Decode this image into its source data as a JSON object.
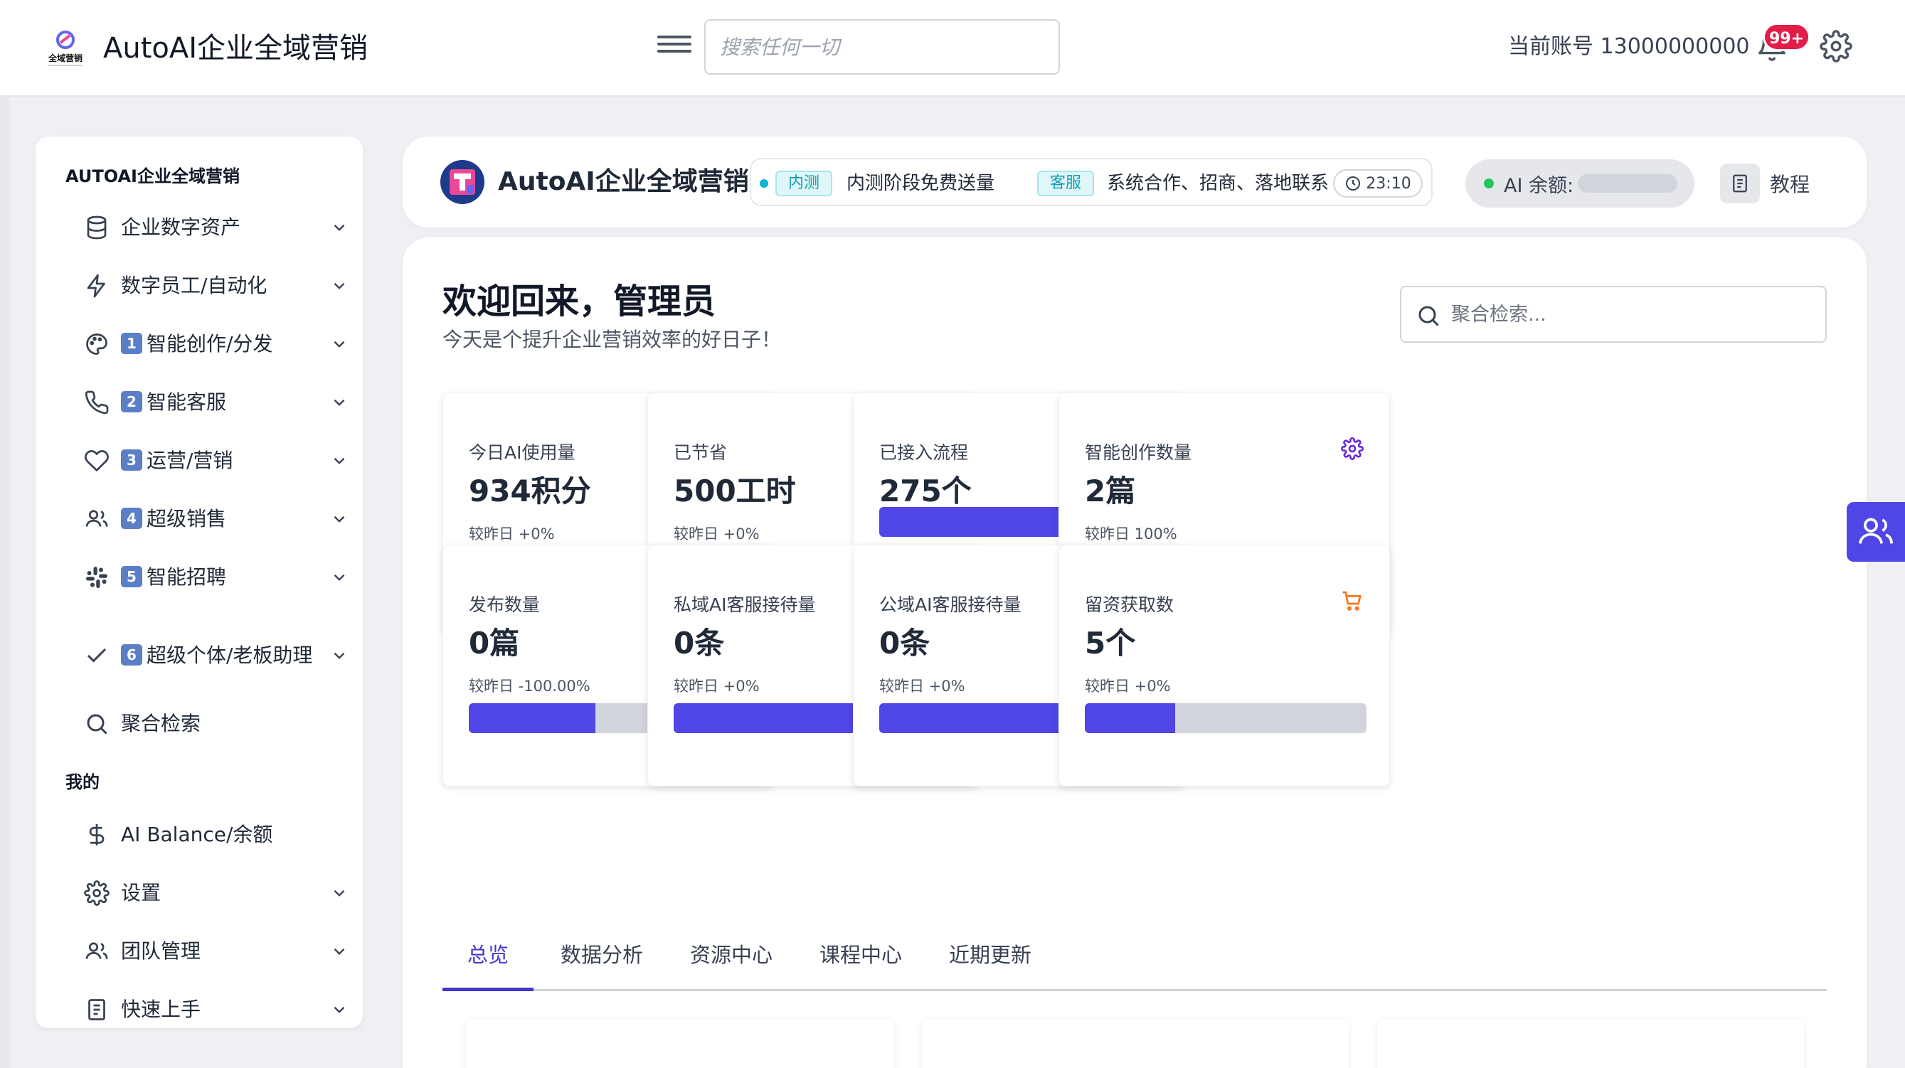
{
  "topbar": {
    "logo_text": "全域营销",
    "app_title": "AutoAI企业全域营销",
    "search_placeholder": "搜索任何一切",
    "account_label": "当前账号 13000000000",
    "notification_badge": "99+"
  },
  "sidebar": {
    "section_main": "AUTOAI企业全域营销",
    "items": [
      {
        "label": "企业数字资产",
        "icon": "database-icon",
        "expandable": true
      },
      {
        "label": "数字员工/自动化",
        "icon": "lightning-icon",
        "expandable": true
      },
      {
        "num": "1",
        "label": "智能创作/分发",
        "icon": "palette-icon",
        "expandable": true
      },
      {
        "num": "2",
        "label": "智能客服",
        "icon": "phone-icon",
        "expandable": true
      },
      {
        "num": "3",
        "label": "运营/营销",
        "icon": "heart-icon",
        "expandable": true
      },
      {
        "num": "4",
        "label": "超级销售",
        "icon": "users-icon",
        "expandable": true
      },
      {
        "num": "5",
        "label": "智能招聘",
        "icon": "slack-icon",
        "expandable": true
      },
      {
        "num": "6",
        "label": "超级个体/老板助理",
        "icon": "check-icon",
        "expandable": true
      },
      {
        "label": "聚合检索",
        "icon": "search-icon",
        "expandable": false
      }
    ],
    "section_mine": "我的",
    "mine_items": [
      {
        "label": "AI Balance/余额",
        "icon": "dollar-icon",
        "expandable": false
      },
      {
        "label": "设置",
        "icon": "gear-icon",
        "expandable": true
      },
      {
        "label": "团队管理",
        "icon": "users-icon",
        "expandable": true
      },
      {
        "label": "快速上手",
        "icon": "book-icon",
        "expandable": true
      }
    ]
  },
  "header": {
    "brand_name": "AutoAI企业全域营销",
    "ticker": {
      "tag1": "内测",
      "text1": "内测阶段免费送量",
      "tag2": "客服",
      "text2": "系统合作、招商、落地联系",
      "time": "23:10"
    },
    "balance_label": "AI 余额:",
    "tutorial_label": "教程"
  },
  "main": {
    "welcome_title": "欢迎回来，管理员",
    "welcome_subtitle": "今天是个提升企业营销效率的好日子！",
    "search_placeholder": "聚合检索...",
    "stats": [
      {
        "label": "今日AI使用量",
        "value": "934积分",
        "compare": "较昨日 +0%",
        "progress": 0.65,
        "icon": "lightning-icon",
        "icon_color": "#2563eb"
      },
      {
        "label": "已节省",
        "value": "500工时",
        "compare": "较昨日 +0%",
        "progress": 0.65,
        "icon": "lightning-icon",
        "icon_color": "#2563eb"
      },
      {
        "label": "已接入流程",
        "value": "275个",
        "compare": "",
        "progress": 0.65,
        "icon": "lightning-icon",
        "icon_color": "#2563eb"
      },
      {
        "label": "智能创作数量",
        "value": "2篇",
        "compare": "较昨日 100%",
        "progress": 0.45,
        "icon": "gear-icon",
        "icon_color": "#6d28d9"
      },
      {
        "label": "发布数量",
        "value": "0篇",
        "compare": "较昨日 -100.00%",
        "progress": 0.45,
        "icon": "gear-icon",
        "icon_color": "#6d28d9"
      },
      {
        "label": "私域AI客服接待量",
        "value": "0条",
        "compare": "较昨日 +0%",
        "progress": 0.78,
        "icon": "chat-icon",
        "icon_color": "#16a34a"
      },
      {
        "label": "公域AI客服接待量",
        "value": "0条",
        "compare": "较昨日 +0%",
        "progress": 0.78,
        "icon": "chat-icon",
        "icon_color": "#16a34a"
      },
      {
        "label": "留资获取数",
        "value": "5个",
        "compare": "较昨日 +0%",
        "progress": 0.32,
        "icon": "cart-icon",
        "icon_color": "#f97316"
      }
    ],
    "tabs": [
      {
        "label": "总览",
        "active": true
      },
      {
        "label": "数据分析",
        "active": false
      },
      {
        "label": "资源中心",
        "active": false
      },
      {
        "label": "课程中心",
        "active": false
      },
      {
        "label": "近期更新",
        "active": false
      }
    ]
  },
  "colors": {
    "accent": "#4f46e5",
    "badge": "#e11d48",
    "ticker_tag": "#0e9fb3"
  }
}
